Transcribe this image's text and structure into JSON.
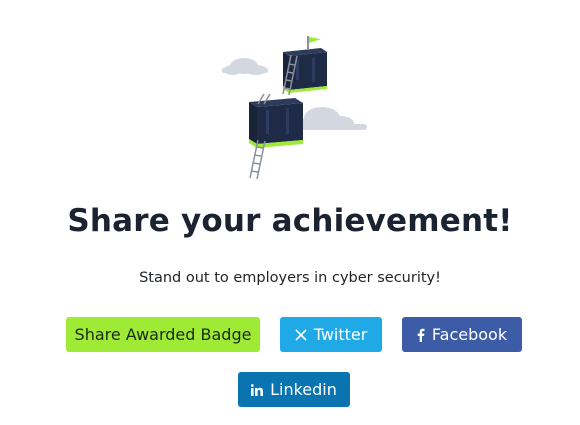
{
  "heading": "Share your achievement!",
  "subheading": "Stand out to employers in cyber security!",
  "buttons": {
    "badge": {
      "label": "Share Awarded Badge",
      "color": "#9fea35"
    },
    "twitter": {
      "label": "Twitter",
      "icon": "x-icon",
      "color": "#1fa9e6"
    },
    "facebook": {
      "label": "Facebook",
      "icon": "facebook-icon",
      "color": "#3d5ca8"
    },
    "linkedin": {
      "label": "Linkedin",
      "icon": "linkedin-icon",
      "color": "#0a74b0"
    }
  },
  "illustration": {
    "description_icon": "floating-cubes-with-ladders-and-flag",
    "accent_color": "#9fea35",
    "cube_color": "#1e2a44"
  }
}
